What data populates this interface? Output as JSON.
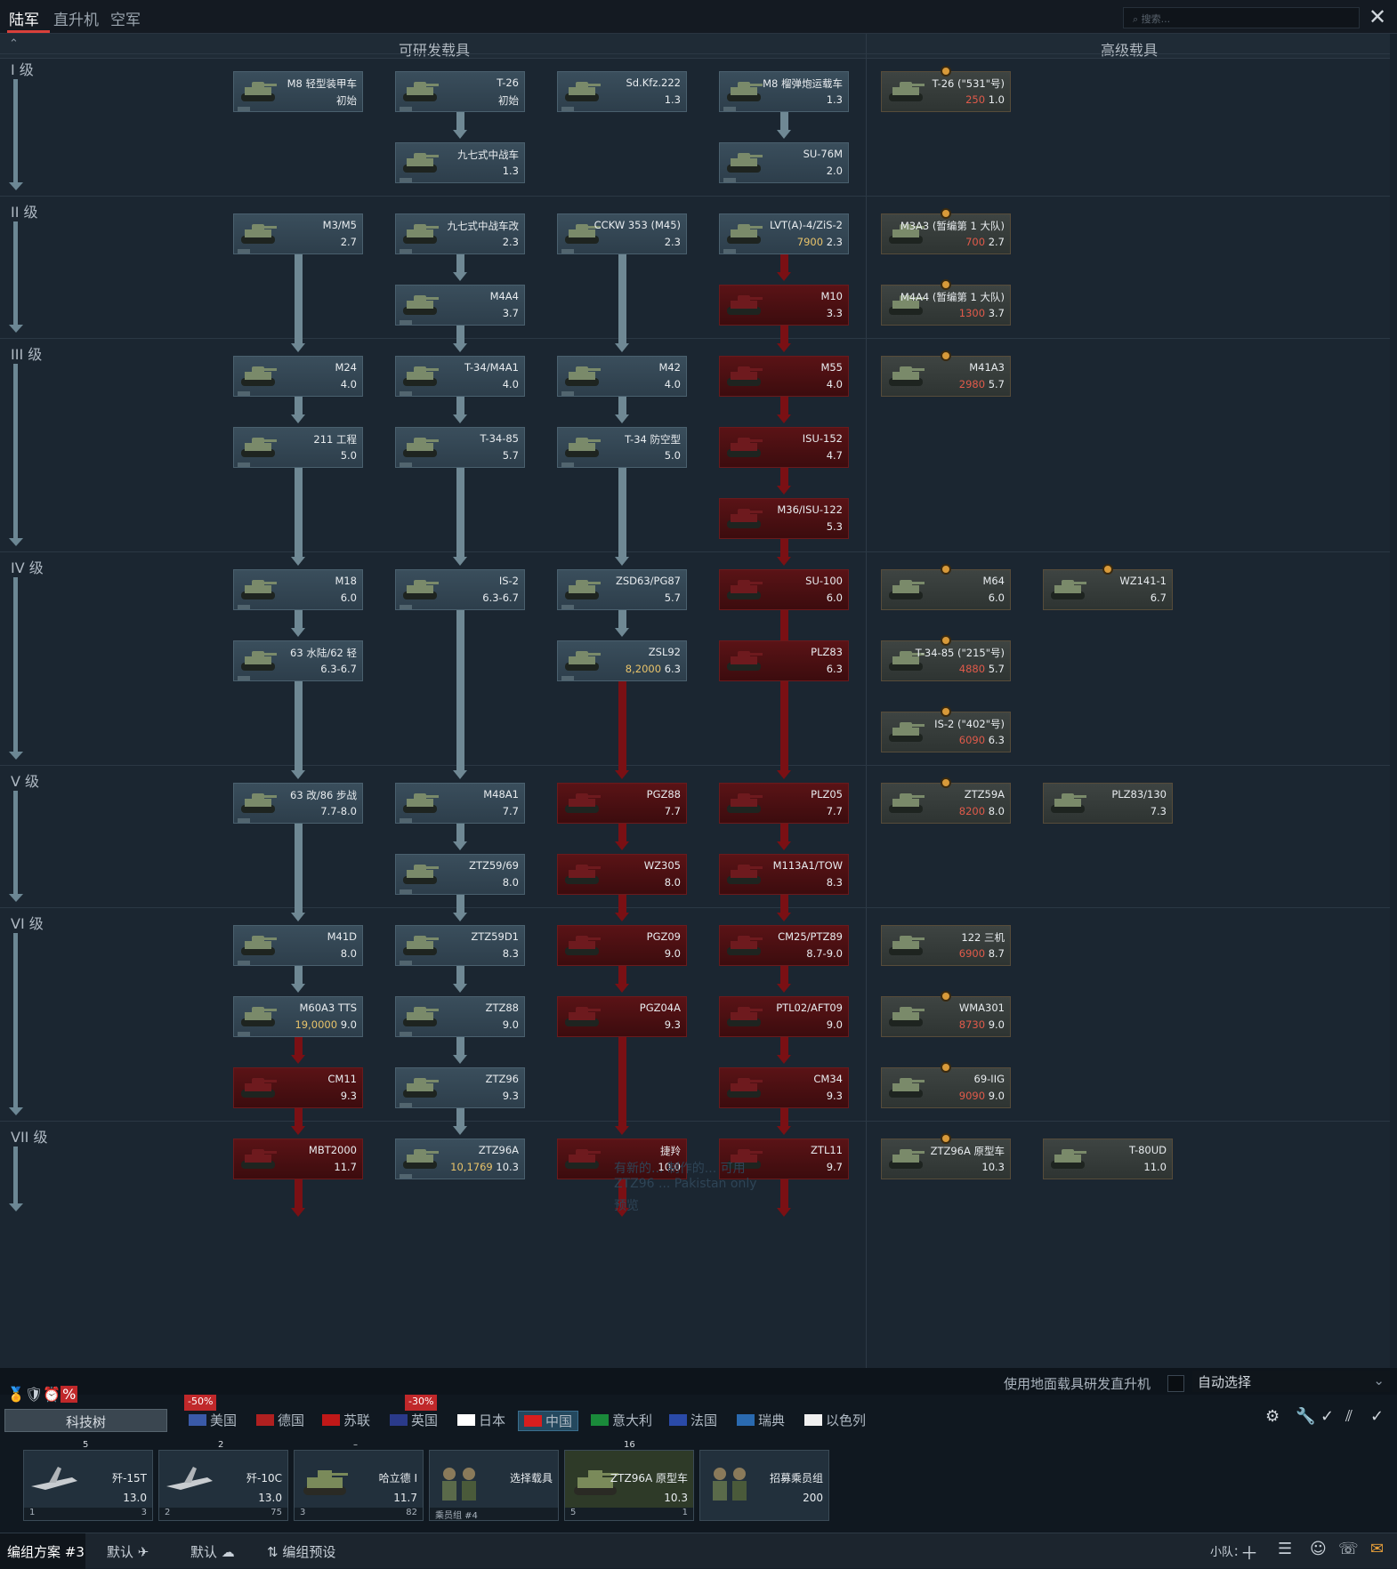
{
  "topbar": {
    "tabs": [
      "陆军",
      "直升机",
      "空军"
    ],
    "search_placeholder": "搜索..."
  },
  "columns": {
    "researchable": "可研发载具",
    "premium": "高级载具"
  },
  "ranks": [
    "I 级",
    "II 级",
    "III 级",
    "IV 级",
    "V 级",
    "VI 级",
    "VII 级"
  ],
  "vehicles": {
    "m8_hmc_lt": {
      "name": "M8 轻型装甲车",
      "br": "初始"
    },
    "t26": {
      "name": "T-26",
      "br": "初始"
    },
    "sdkfz222": {
      "name": "Sd.Kfz.222",
      "br": "1.3"
    },
    "m8_hmc": {
      "name": "M8 榴弹炮运载车",
      "br": "1.3"
    },
    "t26_531": {
      "name": "T-26 (\"531\"号)",
      "cost": "250",
      "br": "1.0"
    },
    "type97_chiha": {
      "name": "九七式中战车",
      "br": "1.3"
    },
    "su76m": {
      "name": "SU-76M",
      "br": "2.0"
    },
    "m3m5": {
      "name": "M3/M5",
      "br": "2.7"
    },
    "type97_kai": {
      "name": "九七式中战车改",
      "br": "2.3"
    },
    "cckw353": {
      "name": "CCKW 353 (M45)",
      "br": "2.3"
    },
    "lvt_zis2": {
      "name": "LVT(A)-4/ZiS-2",
      "cost": "7900",
      "br": "2.3"
    },
    "m3a3_p1": {
      "name": "M3A3 (暂编第 1 大队)",
      "cost": "700",
      "br": "2.7"
    },
    "m4a4": {
      "name": "M4A4",
      "br": "3.7"
    },
    "m10": {
      "name": "M10",
      "br": "3.3"
    },
    "m4a4_p1": {
      "name": "M4A4 (暂编第 1 大队)",
      "cost": "1300",
      "br": "3.7"
    },
    "m24": {
      "name": "M24",
      "br": "4.0"
    },
    "t34m4a1": {
      "name": "T-34/M4A1",
      "br": "4.0"
    },
    "m42": {
      "name": "M42",
      "br": "4.0"
    },
    "m55": {
      "name": "M55",
      "br": "4.0"
    },
    "m41a3": {
      "name": "M41A3",
      "cost": "2980",
      "br": "5.7"
    },
    "type211": {
      "name": "211 工程",
      "br": "5.0"
    },
    "t3485": {
      "name": "T-34-85",
      "br": "5.7"
    },
    "t34_aa": {
      "name": "T-34 防空型",
      "br": "5.0"
    },
    "isu152": {
      "name": "ISU-152",
      "br": "4.7"
    },
    "m36_isu122": {
      "name": "M36/ISU-122",
      "br": "5.3"
    },
    "m18": {
      "name": "M18",
      "br": "6.0"
    },
    "is2": {
      "name": "IS-2",
      "br": "6.3-6.7"
    },
    "zsd63": {
      "name": "ZSD63/PG87",
      "br": "5.7"
    },
    "su100": {
      "name": "SU-100",
      "br": "6.0"
    },
    "m64": {
      "name": "M64",
      "br": "6.0"
    },
    "wz141": {
      "name": "WZ141-1",
      "br": "6.7"
    },
    "type63_62": {
      "name": "63 水陆/62 轻",
      "br": "6.3-6.7"
    },
    "zsl92": {
      "name": "ZSL92",
      "cost": "8,2000",
      "br": "6.3"
    },
    "plz83": {
      "name": "PLZ83",
      "br": "6.3"
    },
    "t3485_215": {
      "name": "T-34-85 (\"215\"号)",
      "cost": "4880",
      "br": "5.7"
    },
    "is2_402": {
      "name": "IS-2 (\"402\"号)",
      "cost": "6090",
      "br": "6.3"
    },
    "type63_86": {
      "name": "63 改/86 步战",
      "br": "7.7-8.0"
    },
    "m48a1": {
      "name": "M48A1",
      "br": "7.7"
    },
    "pgz88": {
      "name": "PGZ88",
      "br": "7.7"
    },
    "plz05": {
      "name": "PLZ05",
      "br": "7.7"
    },
    "ztz59a": {
      "name": "ZTZ59A",
      "cost": "8200",
      "br": "8.0"
    },
    "plz83_130": {
      "name": "PLZ83/130",
      "br": "7.3"
    },
    "ztz59_69": {
      "name": "ZTZ59/69",
      "br": "8.0"
    },
    "wz305": {
      "name": "WZ305",
      "br": "8.0"
    },
    "m113a1": {
      "name": "M113A1/TOW",
      "br": "8.3"
    },
    "m41d": {
      "name": "M41D",
      "br": "8.0"
    },
    "ztz59d1": {
      "name": "ZTZ59D1",
      "br": "8.3"
    },
    "pgz09": {
      "name": "PGZ09",
      "br": "9.0"
    },
    "cm25": {
      "name": "CM25/PTZ89",
      "br": "8.7-9.0"
    },
    "type122": {
      "name": "122 三机",
      "cost": "6900",
      "br": "8.7"
    },
    "m60a3": {
      "name": "M60A3 TTS",
      "cost": "19,0000",
      "br": "9.0"
    },
    "ztz88": {
      "name": "ZTZ88",
      "br": "9.0"
    },
    "pgz04a": {
      "name": "PGZ04A",
      "br": "9.3"
    },
    "ptl02": {
      "name": "PTL02/AFT09",
      "br": "9.0"
    },
    "wma301": {
      "name": "WMA301",
      "cost": "8730",
      "br": "9.0"
    },
    "cm11": {
      "name": "CM11",
      "br": "9.3"
    },
    "ztz96": {
      "name": "ZTZ96",
      "br": "9.3"
    },
    "cm34": {
      "name": "CM34",
      "br": "9.3"
    },
    "type69iig": {
      "name": "69-IIG",
      "cost": "9090",
      "br": "9.0"
    },
    "mbt2000": {
      "name": "MBT2000",
      "br": "11.7"
    },
    "ztz96a": {
      "name": "ZTZ96A",
      "cost": "10,1769",
      "br": "10.3"
    },
    "jiejian": {
      "name": "捷羚",
      "br": "10.0"
    },
    "ztl11": {
      "name": "ZTL11",
      "br": "9.7"
    },
    "ztz96a_proto": {
      "name": "ZTZ96A 原型车",
      "br": "10.3"
    },
    "t80ud": {
      "name": "T-80UD",
      "br": "11.0"
    }
  },
  "overlay": {
    "line1": "有新的... 制作的... 可用",
    "line2": "ZTZ96 ... Pakistan only",
    "preview": "预览"
  },
  "research": {
    "label": "使用地面载具研发直升机",
    "select": "自动选择"
  },
  "techtree_button": "科技树",
  "discounts": {
    "usa": "-50%",
    "uk": "-30%"
  },
  "nations": [
    "美国",
    "德国",
    "苏联",
    "英国",
    "日本",
    "中国",
    "意大利",
    "法国",
    "瑞典",
    "以色列"
  ],
  "selected_nation": "中国",
  "crew": [
    {
      "slot": "5",
      "name": "歼-15T",
      "br": "13.0",
      "num": "1",
      "extra": "3"
    },
    {
      "slot": "2",
      "name": "歼-10C",
      "br": "13.0",
      "num": "2",
      "extra": "75"
    },
    {
      "slot": "–",
      "name": "哈立德 I",
      "br": "11.7",
      "num": "3",
      "extra": "82"
    },
    {
      "slot": "",
      "name": "选择载具",
      "br": "",
      "num": "乘员组 #4",
      "extra": ""
    },
    {
      "slot": "16",
      "name": "ZTZ96A 原型车",
      "br": "10.3",
      "num": "5",
      "extra": "1"
    },
    {
      "slot": "",
      "name": "招募乘员组",
      "br": "200",
      "num": "",
      "extra": ""
    }
  ],
  "statusbar": {
    "preset": "编组方案 #3",
    "default1": "默认",
    "default2": "默认",
    "presets": "编组预设",
    "squad": "小队："
  },
  "colors": {
    "accent": "#d8403a",
    "locked": "#5a1316",
    "line": "#6f8894",
    "selected_nation": "#24485e"
  }
}
